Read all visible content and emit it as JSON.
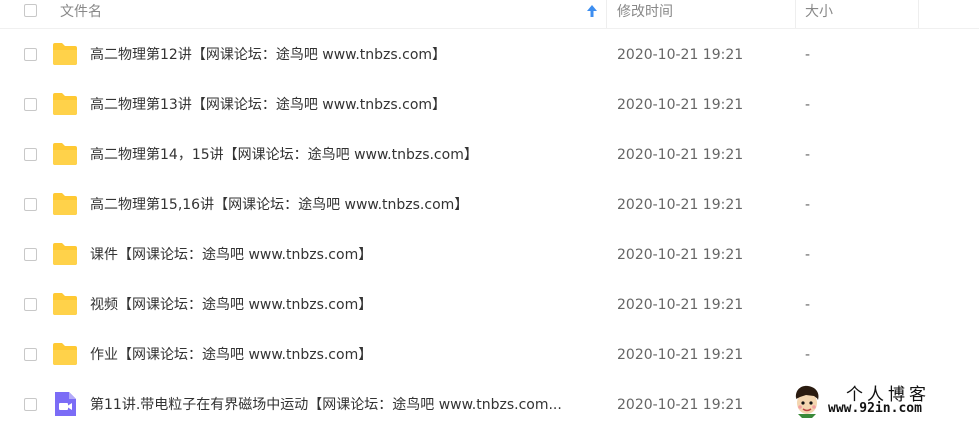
{
  "header": {
    "name_label": "文件名",
    "modified_label": "修改时间",
    "size_label": "大小",
    "sort_indicator_icon": "arrow-up-icon"
  },
  "colors": {
    "folder": "#ffc933",
    "video_icon": "#7b6cf6",
    "sort_arrow": "#3d8ef0"
  },
  "files": [
    {
      "name": "高二物理第12讲【网课论坛：途鸟吧 www.tnbzs.com】",
      "modified": "2020-10-21 19:21",
      "size": "-",
      "type": "folder"
    },
    {
      "name": "高二物理第13讲【网课论坛：途鸟吧 www.tnbzs.com】",
      "modified": "2020-10-21 19:21",
      "size": "-",
      "type": "folder"
    },
    {
      "name": "高二物理第14，15讲【网课论坛：途鸟吧 www.tnbzs.com】",
      "modified": "2020-10-21 19:21",
      "size": "-",
      "type": "folder"
    },
    {
      "name": "高二物理第15,16讲【网课论坛：途鸟吧 www.tnbzs.com】",
      "modified": "2020-10-21 19:21",
      "size": "-",
      "type": "folder"
    },
    {
      "name": "课件【网课论坛：途鸟吧 www.tnbzs.com】",
      "modified": "2020-10-21 19:21",
      "size": "-",
      "type": "folder"
    },
    {
      "name": "视频【网课论坛：途鸟吧 www.tnbzs.com】",
      "modified": "2020-10-21 19:21",
      "size": "-",
      "type": "folder"
    },
    {
      "name": "作业【网课论坛：途鸟吧 www.tnbzs.com】",
      "modified": "2020-10-21 19:21",
      "size": "-",
      "type": "folder"
    },
    {
      "name": "第11讲.带电粒子在有界磁场中运动【网课论坛：途鸟吧 www.tnbzs.com...",
      "modified": "2020-10-21 19:21",
      "size": "",
      "type": "video"
    }
  ],
  "watermark": {
    "title": "个人博客",
    "url": "www.92in.com"
  }
}
